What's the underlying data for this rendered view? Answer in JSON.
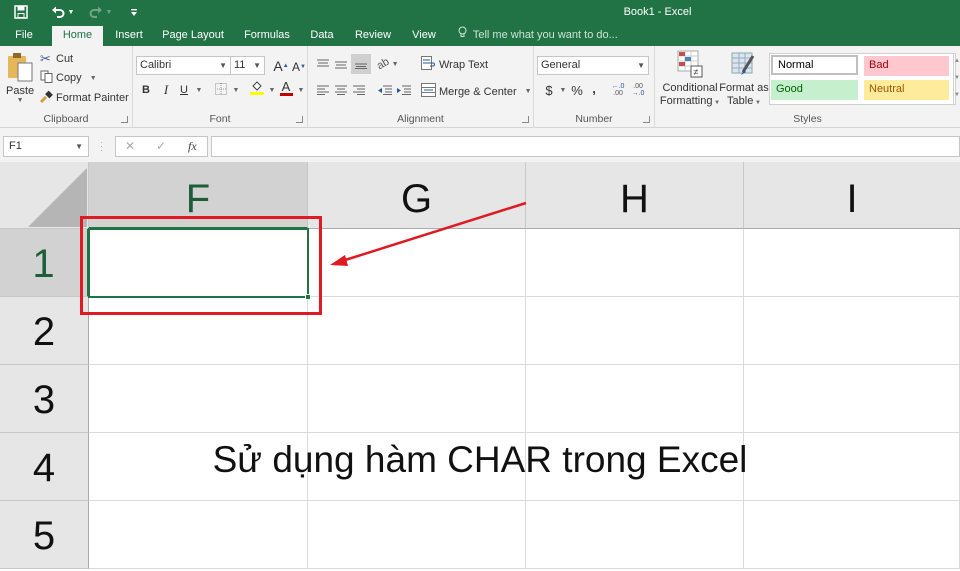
{
  "window": {
    "title": "Book1 - Excel",
    "quick_access": [
      {
        "name": "save-icon",
        "glyph": "💾"
      },
      {
        "name": "undo-icon",
        "glyph": "↶"
      },
      {
        "name": "redo-icon",
        "glyph": "↷"
      },
      {
        "name": "customize-qat-icon",
        "glyph": "="
      }
    ]
  },
  "tabs": [
    {
      "label": "File",
      "active": false
    },
    {
      "label": "Home",
      "active": true
    },
    {
      "label": "Insert",
      "active": false
    },
    {
      "label": "Page Layout",
      "active": false
    },
    {
      "label": "Formulas",
      "active": false
    },
    {
      "label": "Data",
      "active": false
    },
    {
      "label": "Review",
      "active": false
    },
    {
      "label": "View",
      "active": false
    }
  ],
  "tell_me": {
    "placeholder": "Tell me what you want to do..."
  },
  "ribbon": {
    "clipboard": {
      "label": "Clipboard",
      "paste": "Paste",
      "cut": "Cut",
      "copy": "Copy",
      "format_painter": "Format Painter"
    },
    "font": {
      "label": "Font",
      "font_name": "Calibri",
      "font_size": "11",
      "bold": "B",
      "italic": "I",
      "underline": "U",
      "grow": "A",
      "shrink": "A",
      "font_color_letter": "A",
      "fill_color": "#ffff00",
      "font_color": "#c00000"
    },
    "alignment": {
      "label": "Alignment",
      "wrap_text": "Wrap Text",
      "merge_center": "Merge & Center"
    },
    "number": {
      "label": "Number",
      "format": "General",
      "currency": "$",
      "percent": "%",
      "comma": ",",
      "inc_decimal": "←.0 .00",
      "dec_decimal": ".00 →.0"
    },
    "styles": {
      "label": "Styles",
      "conditional_formatting": [
        "Conditional",
        "Formatting"
      ],
      "format_as_table": [
        "Format as",
        "Table"
      ],
      "cells": [
        {
          "label": "Normal",
          "bg": "#ffffff",
          "fg": "#000000"
        },
        {
          "label": "Bad",
          "bg": "#ffc7ce",
          "fg": "#9c0006"
        },
        {
          "label": "Good",
          "bg": "#c6efce",
          "fg": "#006100"
        },
        {
          "label": "Neutral",
          "bg": "#ffeb9c",
          "fg": "#9c5700"
        }
      ]
    }
  },
  "formula_bar": {
    "name_box": "F1",
    "cancel": "✕",
    "enter": "✓",
    "fx": "fx",
    "value": ""
  },
  "sheet": {
    "columns": [
      "F",
      "G",
      "H",
      "I"
    ],
    "rows": [
      "1",
      "2",
      "3",
      "4",
      "5"
    ],
    "selected_cell": "F1",
    "selected_column": "F",
    "selected_row": "1"
  },
  "annotation": {
    "caption": "Sử dụng hàm CHAR trong Excel",
    "color": "#e01a22"
  }
}
